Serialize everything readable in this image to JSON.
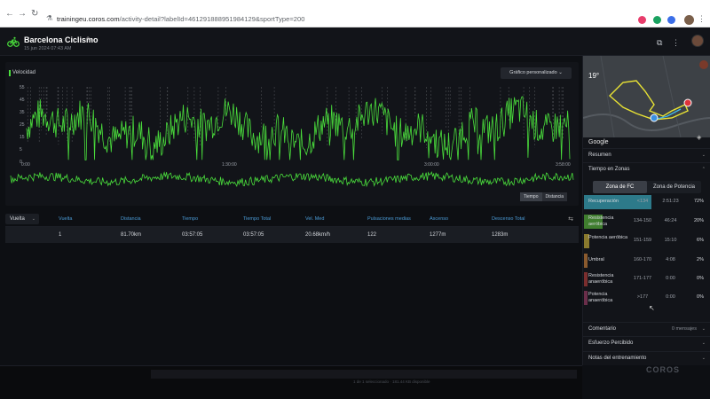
{
  "browser": {
    "url_host": "trainingeu.coros.com",
    "url_path": "/activity-detail?labelId=461291888951984129&sportType=200",
    "back_icon": "arrow-left-icon",
    "forward_icon": "arrow-right-icon",
    "reload_icon": "reload-icon"
  },
  "header": {
    "title": "Barcelona Ciclismo",
    "date": "15 jun 2024 07:43 AM"
  },
  "chart": {
    "metric_label": "Velocidad",
    "custom_button": "Gráfico personalizado",
    "x_ticks": [
      "0:00",
      "1:30:00",
      "3:00:00",
      "3:58:00"
    ],
    "y_ticks": [
      "55",
      "45",
      "35",
      "25",
      "15",
      "5",
      "0"
    ],
    "tab_time": "Tiempo",
    "tab_distance": "Distancia",
    "series_color": "#4ade3c"
  },
  "table": {
    "lap_select": "Vuelta",
    "headers": [
      "Vuelta",
      "Distancia",
      "Tiempo",
      "Tiempo Total",
      "Vel. Med",
      "Pulsaciones medias",
      "Ascenso",
      "Descenso Total"
    ],
    "rows": [
      [
        "1",
        "81.70km",
        "03:57:05",
        "03:57:05",
        "20.68km/h",
        "122",
        "1277m",
        "1283m"
      ]
    ]
  },
  "right_panel": {
    "temperature": "19°",
    "google": "Google",
    "sections": {
      "summary": "Resumen",
      "zones": "Tiempo en Zonas",
      "comment": "Comentario",
      "comment_extra": "0 mensajes",
      "perceived": "Esfuerzo Percibido",
      "notes": "Notas del entrenamiento"
    },
    "zone_tabs": [
      "Zona de FC",
      "Zona de Potencia"
    ],
    "zones": [
      {
        "name": "Recuperación",
        "range": "<134",
        "time": "2:51:23",
        "pct": "72%",
        "color": "#2d7a8a",
        "fill": 0.72
      },
      {
        "name": "Resistencia aeróbica",
        "range": "134-150",
        "time": "46:24",
        "pct": "20%",
        "color": "#3f7d2e",
        "fill": 0.2
      },
      {
        "name": "Potencia aeróbica",
        "range": "151-159",
        "time": "15:10",
        "pct": "6%",
        "color": "#8a7a2e",
        "fill": 0.06
      },
      {
        "name": "Umbral",
        "range": "160-170",
        "time": "4:08",
        "pct": "2%",
        "color": "#8a5a2e",
        "fill": 0.02
      },
      {
        "name": "Resistencia anaeróbica",
        "range": "171-177",
        "time": "0:00",
        "pct": "0%",
        "color": "#7a2e2e",
        "fill": 0
      },
      {
        "name": "Potencia anaeróbica",
        "range": ">177",
        "time": "0:00",
        "pct": "0%",
        "color": "#6a2e4a",
        "fill": 0
      }
    ]
  },
  "footer": {
    "brand": "COROS",
    "status": "1 de 1 seleccionado  ·  181.44 KB disponible"
  }
}
